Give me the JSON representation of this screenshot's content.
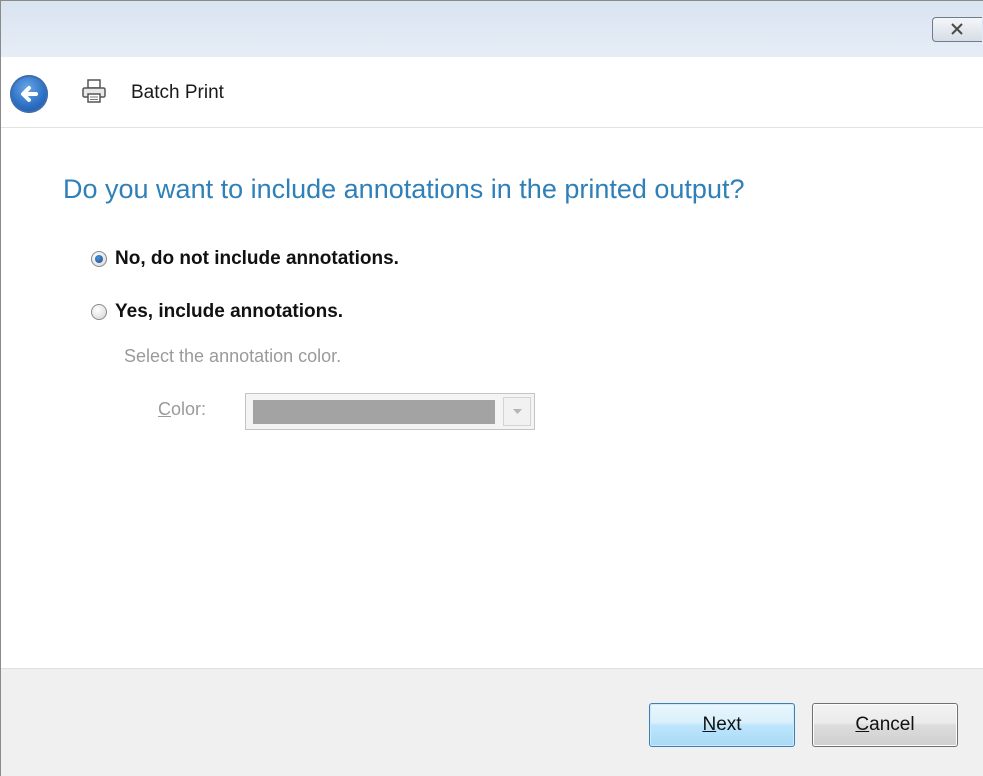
{
  "window": {
    "close_tooltip": ""
  },
  "header": {
    "title": "Batch Print",
    "back_icon": "back-arrow-icon",
    "app_icon": "printer-icon"
  },
  "question": "Do you want to include annotations in the printed output?",
  "options": [
    {
      "label": "No, do not include annotations.",
      "selected": true
    },
    {
      "label": "Yes, include annotations.",
      "selected": false
    }
  ],
  "annotation_color": {
    "hint": "Select the annotation color.",
    "label_accel": "C",
    "label_rest": "olor:",
    "selected_color": "#a3a3a3",
    "enabled": false
  },
  "buttons": {
    "next_accel": "N",
    "next_rest": "ext",
    "cancel_accel": "C",
    "cancel_rest": "ancel"
  },
  "colors": {
    "accent_heading": "#2f7fb8",
    "disabled_text": "#9a9a9a",
    "footer_bg": "#f0f0f0"
  }
}
